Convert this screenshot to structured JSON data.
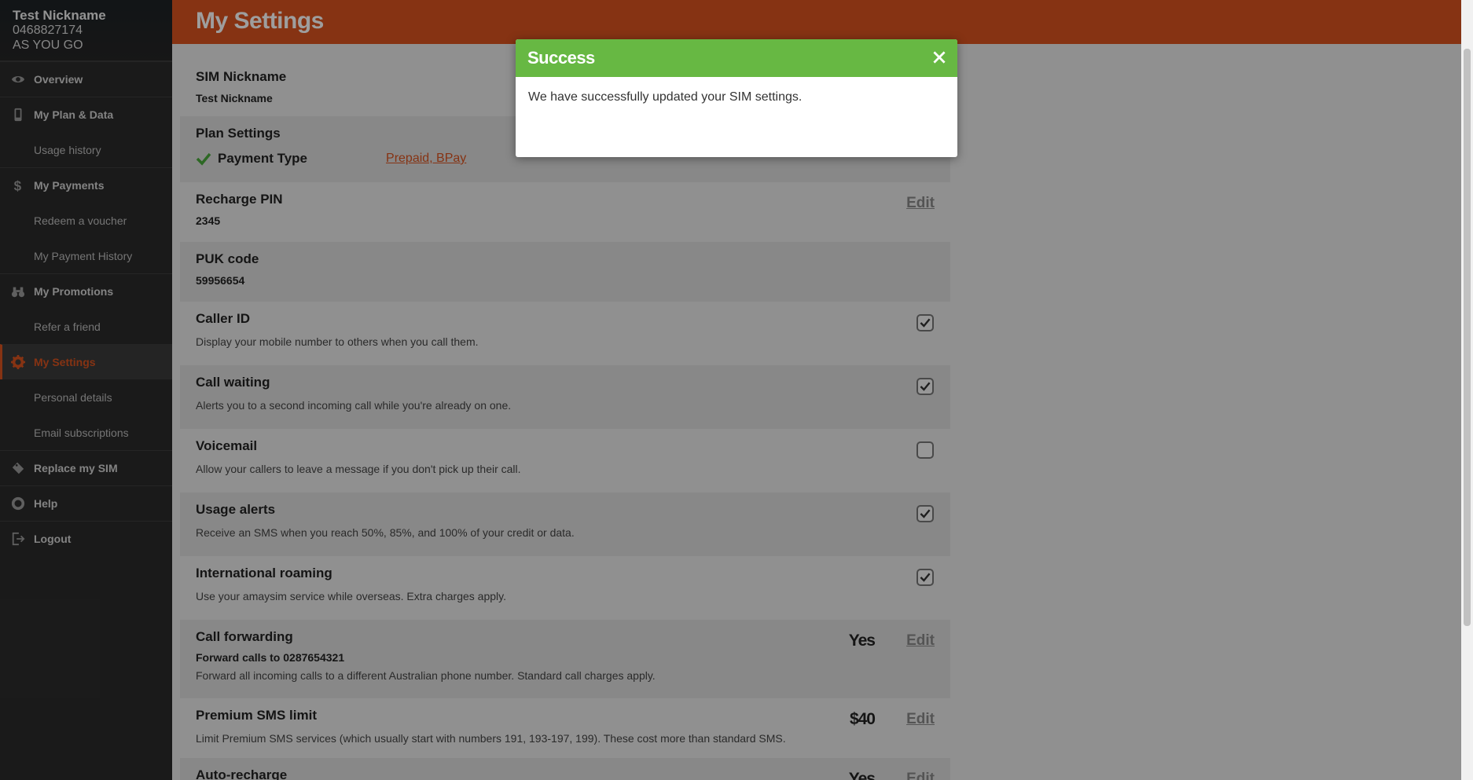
{
  "sim": {
    "nickname": "Test Nickname",
    "number": "0468827174",
    "plan": "AS YOU GO"
  },
  "sidebar": {
    "items": [
      {
        "label": "Overview",
        "icon": "eye-icon"
      },
      {
        "label": "My Plan & Data",
        "icon": "phone-icon"
      },
      {
        "label": "Usage history"
      },
      {
        "label": "My Payments",
        "icon": "dollar-icon"
      },
      {
        "label": "Redeem a voucher"
      },
      {
        "label": "My Payment History"
      },
      {
        "label": "My Promotions",
        "icon": "binoculars-icon"
      },
      {
        "label": "Refer a friend"
      },
      {
        "label": "My Settings",
        "icon": "gear-icon",
        "active": true
      },
      {
        "label": "Personal details"
      },
      {
        "label": "Email subscriptions"
      },
      {
        "label": "Replace my SIM",
        "icon": "sim-icon"
      },
      {
        "label": "Help",
        "icon": "lifebuoy-icon"
      },
      {
        "label": "Logout",
        "icon": "logout-icon"
      }
    ]
  },
  "page": {
    "title": "My Settings"
  },
  "settings": {
    "sim_nickname": {
      "label": "SIM Nickname",
      "value": "Test Nickname"
    },
    "plan_settings": {
      "label": "Plan Settings",
      "payment_type_label": "Payment Type",
      "payment_type_value": "Prepaid, BPay"
    },
    "recharge_pin": {
      "label": "Recharge PIN",
      "value": "2345",
      "edit": "Edit"
    },
    "puk_code": {
      "label": "PUK code",
      "value": "59956654"
    },
    "caller_id": {
      "label": "Caller ID",
      "desc": "Display your mobile number to others when you call them.",
      "checked": true
    },
    "call_waiting": {
      "label": "Call waiting",
      "desc": "Alerts you to a second incoming call while you're already on one.",
      "checked": true
    },
    "voicemail": {
      "label": "Voicemail",
      "desc": "Allow your callers to leave a message if you don't pick up their call.",
      "checked": false
    },
    "usage_alerts": {
      "label": "Usage alerts",
      "desc": "Receive an SMS when you reach 50%, 85%, and 100% of your credit or data.",
      "checked": true
    },
    "intl_roaming": {
      "label": "International roaming",
      "desc": "Use your amaysim service while overseas. Extra charges apply.",
      "checked": true
    },
    "call_forwarding": {
      "label": "Call forwarding",
      "value": "Forward calls to 0287654321",
      "desc": "Forward all incoming calls to a different Australian phone number. Standard call charges apply.",
      "status": "Yes",
      "edit": "Edit"
    },
    "premium_sms": {
      "label": "Premium SMS limit",
      "desc": "Limit Premium SMS services (which usually start with numbers 191, 193-197, 199). These cost more than standard SMS.",
      "amount": "$40",
      "edit": "Edit"
    },
    "auto_recharge": {
      "label": "Auto-recharge",
      "status": "Yes",
      "edit": "Edit"
    }
  },
  "modal": {
    "title": "Success",
    "message": "We have successfully updated your SIM settings."
  },
  "colors": {
    "brand": "#d8531f",
    "success": "#67b843",
    "sidebar": "#2b2b2b"
  }
}
